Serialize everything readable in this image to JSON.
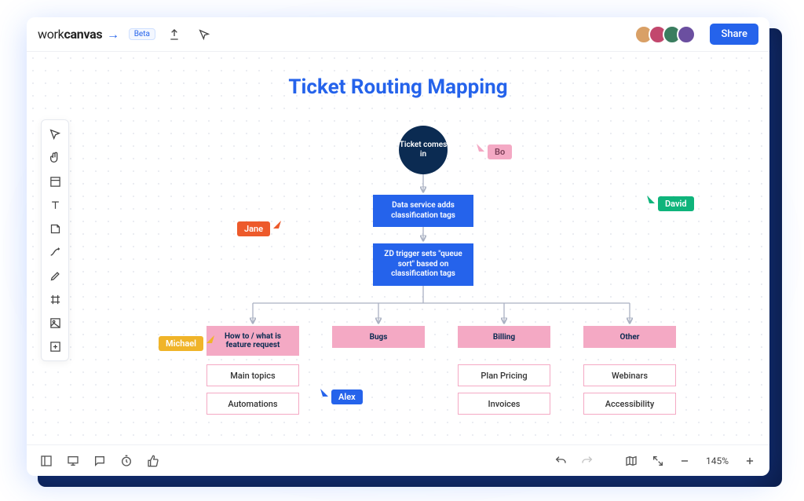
{
  "brand": {
    "part1": "work",
    "part2": "canvas",
    "tag": "Beta"
  },
  "share_label": "Share",
  "avatars": [
    {
      "bg": "#d9a066"
    },
    {
      "bg": "#c2476d"
    },
    {
      "bg": "#3a7d5f"
    },
    {
      "bg": "#6b4fa0"
    }
  ],
  "title": "Ticket Routing Mapping",
  "nodes": {
    "start": "Ticket comes in",
    "step1": "Data service adds classification tags",
    "step2": "ZD trigger sets \"queue sort\" based on classification tags",
    "branches": [
      {
        "header": "How to / what is feature request",
        "items": [
          "Main topics",
          "Automations"
        ]
      },
      {
        "header": "Bugs",
        "items": []
      },
      {
        "header": "Billing",
        "items": [
          "Plan Pricing",
          "Invoices"
        ]
      },
      {
        "header": "Other",
        "items": [
          "Webinars",
          "Accessibility"
        ]
      }
    ]
  },
  "cursors": {
    "jane": {
      "label": "Jane",
      "color": "#ed5a2b"
    },
    "bo": {
      "label": "Bo",
      "color": "#f4a9c4"
    },
    "david": {
      "label": "David",
      "color": "#0fb47b"
    },
    "michael": {
      "label": "Michael",
      "color": "#f0b429"
    },
    "alex": {
      "label": "Alex",
      "color": "#2563eb"
    }
  },
  "zoom": "145%"
}
